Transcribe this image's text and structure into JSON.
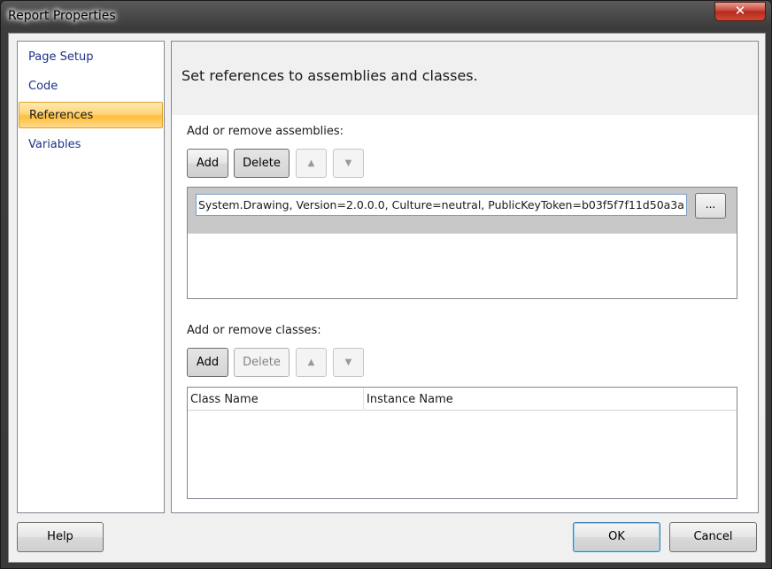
{
  "window": {
    "title": "Report Properties",
    "close_icon": "close-icon"
  },
  "nav": {
    "items": [
      {
        "label": "Page Setup",
        "selected": false
      },
      {
        "label": "Code",
        "selected": false
      },
      {
        "label": "References",
        "selected": true
      },
      {
        "label": "Variables",
        "selected": false
      }
    ]
  },
  "panel": {
    "header": "Set references to assemblies and classes.",
    "assemblies": {
      "label": "Add or remove assemblies:",
      "add_label": "Add",
      "delete_label": "Delete",
      "move_up_icon": "arrow-up-icon",
      "move_down_icon": "arrow-down-icon",
      "items": [
        {
          "value": "System.Drawing, Version=2.0.0.0, Culture=neutral, PublicKeyToken=b03f5f7f11d50a3a",
          "browse_label": "..."
        }
      ]
    },
    "classes": {
      "label": "Add or remove classes:",
      "add_label": "Add",
      "delete_label": "Delete",
      "move_up_icon": "arrow-up-icon",
      "move_down_icon": "arrow-down-icon",
      "columns": [
        "Class Name",
        "Instance Name"
      ],
      "rows": []
    }
  },
  "footer": {
    "help_label": "Help",
    "ok_label": "OK",
    "cancel_label": "Cancel"
  }
}
